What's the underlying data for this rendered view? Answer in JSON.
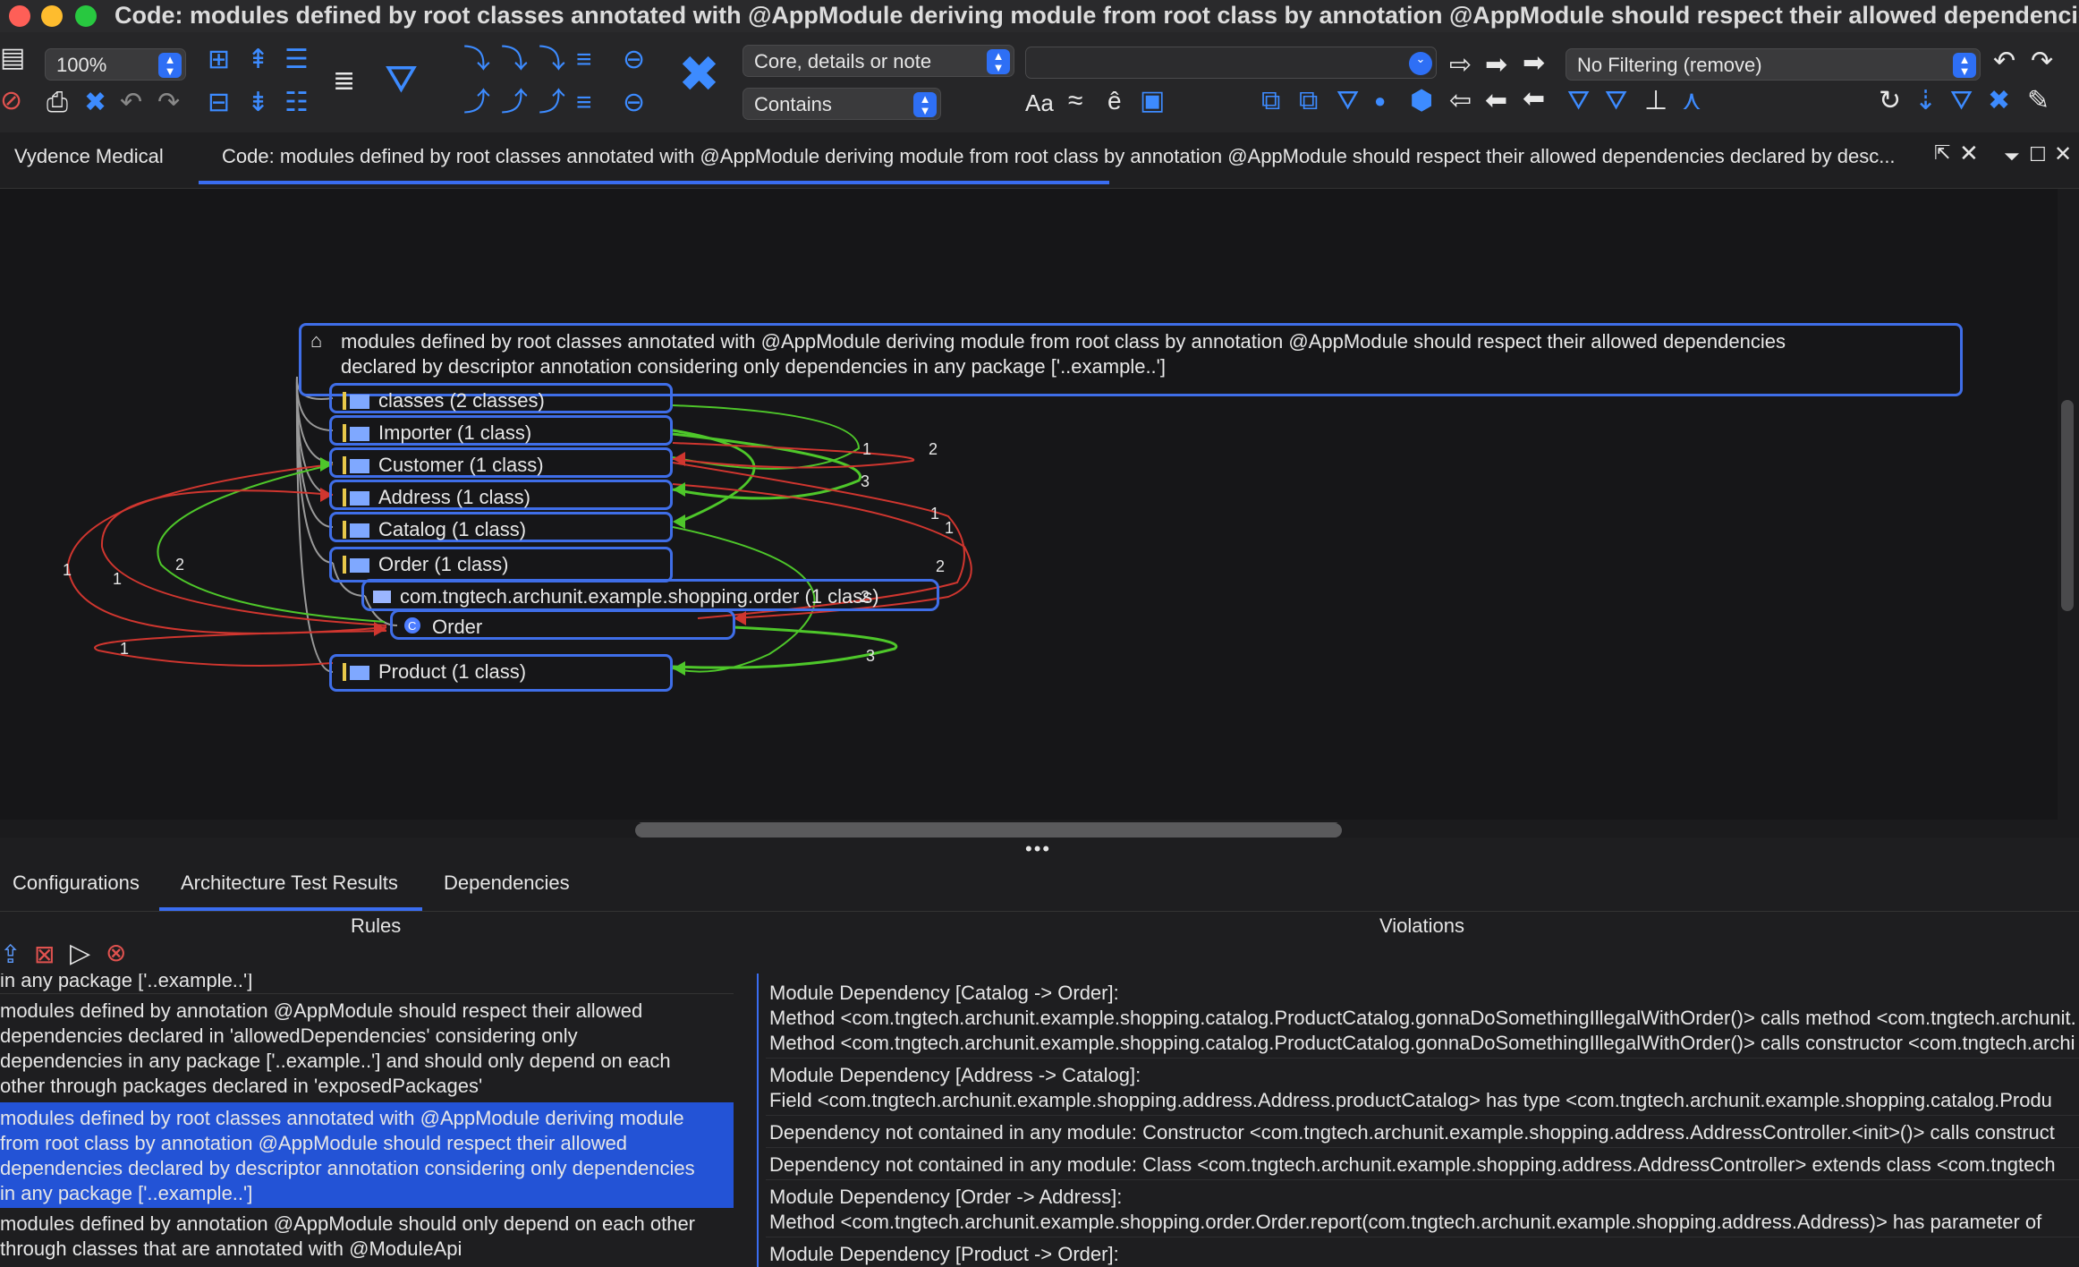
{
  "window": {
    "title": "Code: modules defined by root classes annotated with @AppModule deriving module from root class by annotation @AppModule should respect their allowed dependencie..."
  },
  "toolbar": {
    "zoom": "100%",
    "search_scope": "Core, details or note",
    "search_mode": "Contains",
    "search_text": "",
    "filter": "No Filtering (remove)",
    "case_label": "Aa",
    "approx_label": "≈",
    "accent_label": "ê"
  },
  "tabs": {
    "project": "Vydence Medical",
    "active": "Code: modules defined by root classes annotated with @AppModule deriving module from root class by annotation @AppModule should respect their allowed dependencies declared by desc..."
  },
  "map": {
    "root_line1": "modules defined by root classes annotated with @AppModule deriving module from root class by annotation @AppModule should respect their allowed dependencies",
    "root_line2": "declared by descriptor annotation considering only dependencies in any package ['..example..']",
    "nodes": {
      "classes": "classes (2 classes)",
      "importer": "Importer (1 class)",
      "customer": "Customer (1 class)",
      "address": "Address (1 class)",
      "catalog": "Catalog (1 class)",
      "order": "Order (1 class)",
      "order_pkg": "com.tngtech.archunit.example.shopping.order (1 class)",
      "order_class": "Order",
      "product": "Product (1 class)"
    },
    "edge_labels": {
      "l1": "1",
      "l2": "2",
      "l3": "3",
      "l4": "1",
      "l5": "1",
      "l6": "2",
      "l7": "2",
      "l8": "3",
      "l9": "1",
      "l10": "1",
      "l11": "2",
      "l12": "1"
    },
    "colors": {
      "node_border": "#3f6ee8",
      "edge_red": "#d0362f",
      "edge_green": "#4ec72a"
    }
  },
  "bottom": {
    "tabs": [
      "Configurations",
      "Architecture Test Results",
      "Dependencies"
    ],
    "rules_header": "Rules",
    "violations_header": "Violations",
    "rules": {
      "r0": "in any package ['..example..']",
      "r1": [
        "modules defined by annotation @AppModule should respect their allowed",
        "dependencies declared in 'allowedDependencies' considering only",
        "dependencies in any package ['..example..'] and should only depend on each",
        "other through packages declared in 'exposedPackages'"
      ],
      "r2": [
        "modules defined by root classes annotated with @AppModule deriving module",
        "from root class by annotation @AppModule should respect their allowed",
        "dependencies declared by descriptor annotation considering only dependencies",
        "in any package ['..example..']"
      ],
      "r3": [
        "modules defined by annotation @AppModule should only depend on each other",
        "through classes that are annotated with @ModuleApi"
      ]
    },
    "violations": {
      "v1": [
        "Module Dependency [Catalog -> Order]:",
        "Method <com.tngtech.archunit.example.shopping.catalog.ProductCatalog.gonnaDoSomethingIllegalWithOrder()> calls method <com.tngtech.archunit.",
        "Method <com.tngtech.archunit.example.shopping.catalog.ProductCatalog.gonnaDoSomethingIllegalWithOrder()> calls constructor <com.tngtech.archi"
      ],
      "v2": [
        "Module Dependency [Address -> Catalog]:",
        "Field <com.tngtech.archunit.example.shopping.address.Address.productCatalog> has type <com.tngtech.archunit.example.shopping.catalog.Produ"
      ],
      "v3": [
        "Dependency not contained in any module: Constructor <com.tngtech.archunit.example.shopping.address.AddressController.<init>()> calls construct"
      ],
      "v4": [
        "Dependency not contained in any module: Class <com.tngtech.archunit.example.shopping.address.AddressController> extends class <com.tngtech"
      ],
      "v5": [
        "Module Dependency [Order -> Address]:",
        "Method <com.tngtech.archunit.example.shopping.order.Order.report(com.tngtech.archunit.example.shopping.address.Address)> has parameter of"
      ],
      "v6": [
        "Module Dependency [Product -> Order]:"
      ]
    }
  }
}
